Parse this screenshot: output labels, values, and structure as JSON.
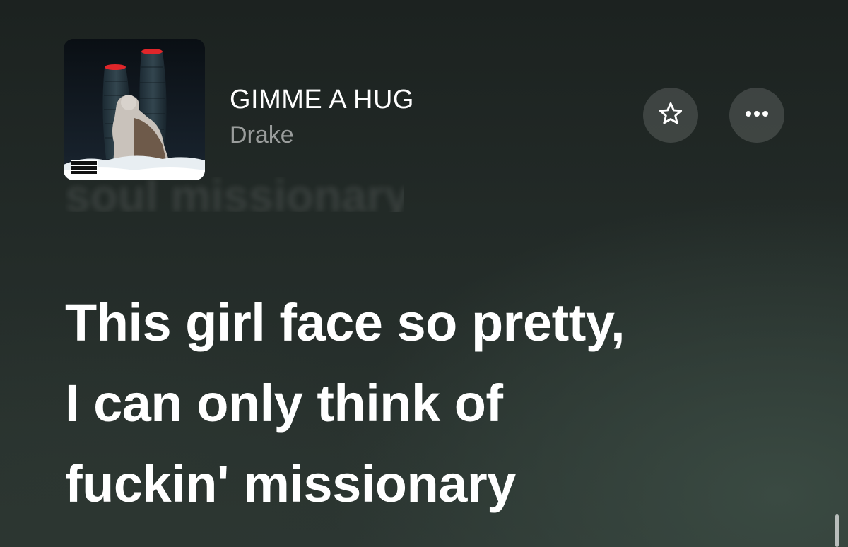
{
  "track": {
    "title": "GIMME A HUG",
    "artist": "Drake"
  },
  "album_art": {
    "advisory_label": "PARENTAL ADVISORY EXPLICIT CONTENT"
  },
  "actions": {
    "favorite_icon": "star-outline-icon",
    "more_icon": "ellipsis-icon"
  },
  "lyrics": {
    "previous_line": "soul missionary",
    "current_lines": [
      "This girl face so pretty,",
      "I can only think of",
      "fuckin' missionary"
    ]
  },
  "colors": {
    "background_top": "#1c2220",
    "background_bottom": "#2c3632",
    "text_primary": "#ffffff",
    "text_secondary": "#8e948f"
  }
}
